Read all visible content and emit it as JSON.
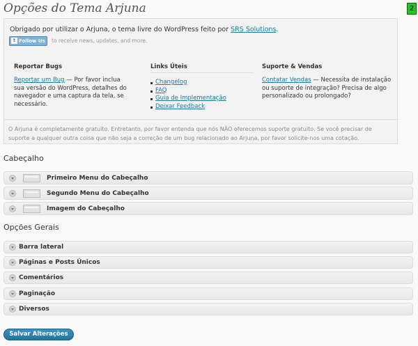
{
  "page": {
    "title": "Opções do Tema Arjuna",
    "corner_badge": "2"
  },
  "info": {
    "thanks_text": "Obrigado por utilizar o Arjuna, o tema livre do WordPress feito por ",
    "thanks_link": "SRS Solutions",
    "thanks_end": ".",
    "follow_button": "Follow Us",
    "follow_icon_glyph": "t",
    "follow_text": "to receive news, updates, and more.",
    "columns": {
      "bugs": {
        "heading": "Reportar Bugs",
        "link": "Reportar um Bug",
        "text": " — Por favor inclua sua versão do WordPress, detalhes do navegador e uma captura da tela, se necessário."
      },
      "links": {
        "heading": "Links Úteis",
        "items": [
          "Changelog",
          "FAQ",
          "Guia de Implementação",
          "Deixar Feedback"
        ]
      },
      "support": {
        "heading": "Suporte & Vendas",
        "link": "Contatar Vendas",
        "text": " — Necessita de instalação ou suporte de integração? Precisa de algo personalizado ou prolongado?"
      }
    },
    "footnote": "O Arjuna é completamente gratuito. Entretanto, por favor entenda que nós NÃO oferecemos suporte gratuito. Se você precisar de suporte a qualquer outra coisa que não seja a correção de um bug relacionado ao Arjuna, por favor solicite-nos uma cotação."
  },
  "sections": {
    "header": {
      "title": "Cabeçalho",
      "panels": [
        "Primeiro Menu do Cabeçalho",
        "Segundo Menu do Cabeçalho",
        "Imagem do Cabeçalho"
      ]
    },
    "general": {
      "title": "Opções Gerais",
      "panels": [
        "Barra lateral",
        "Páginas e Posts Únicos",
        "Comentários",
        "Paginação",
        "Diversos"
      ]
    }
  },
  "save_button": "Salvar Alterações",
  "colors": {
    "accent": "#21759b",
    "badge": "#22c322",
    "follow": "#7fb3d8"
  },
  "icons": {
    "panel_toggle": "chevron-down-icon",
    "panel_thumb": "menu-thumbnail-icon",
    "follow": "twitter-icon"
  }
}
